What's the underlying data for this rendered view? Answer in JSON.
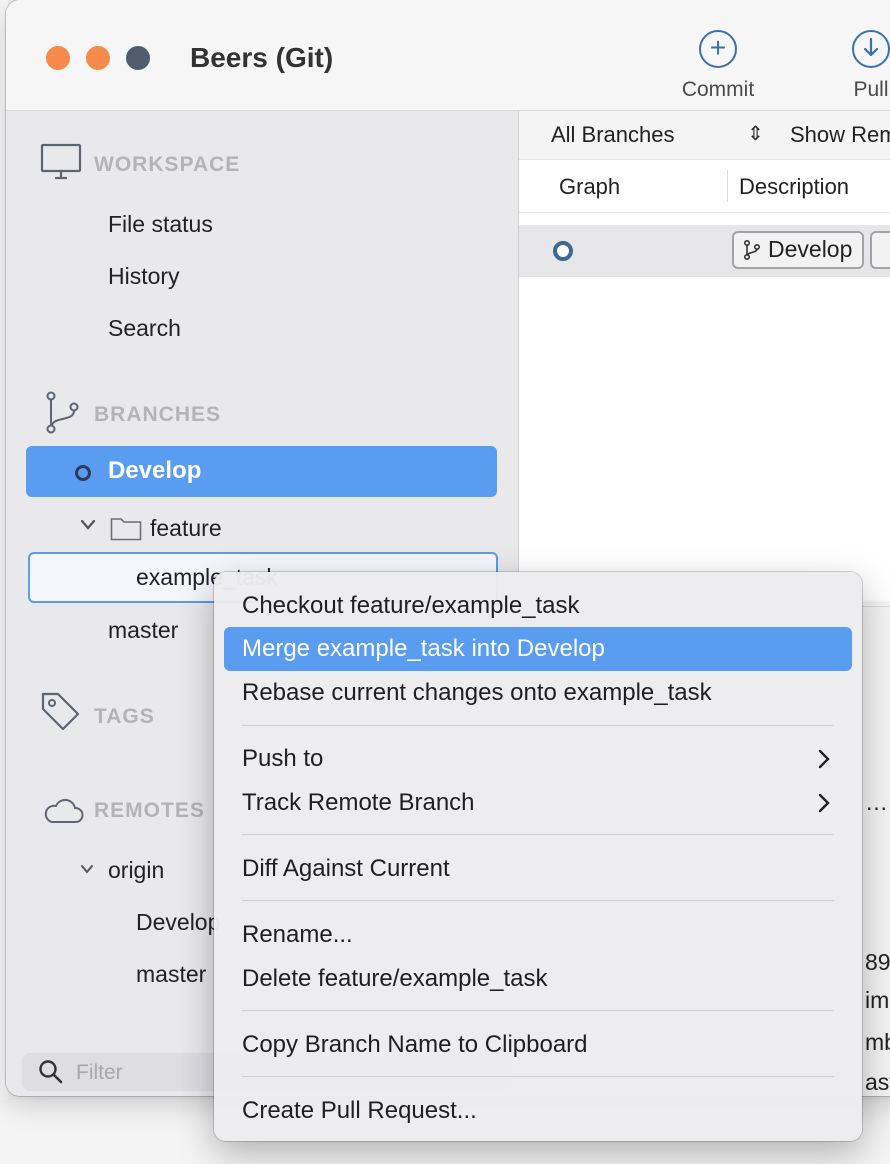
{
  "window": {
    "title": "Beers (Git)",
    "toolbar": {
      "commit_label": "Commit",
      "pull_label": "Pull"
    }
  },
  "sidebar": {
    "workspace": {
      "header": "WORKSPACE",
      "items": [
        "File status",
        "History",
        "Search"
      ]
    },
    "branches": {
      "header": "BRANCHES",
      "current": "Develop",
      "folder": "feature",
      "folder_item": "example_task",
      "master": "master"
    },
    "tags": {
      "header": "TAGS"
    },
    "remotes": {
      "header": "REMOTES",
      "origin": "origin",
      "origin_items": [
        "Develop",
        "master"
      ]
    },
    "filter_placeholder": "Filter"
  },
  "main": {
    "branch_selector": "All Branches",
    "show_remote_label": "Show Remote Branches",
    "columns": {
      "graph": "Graph",
      "description": "Description"
    },
    "commit_badge": "Develop",
    "edge_texts": [
      "…",
      "89",
      "im",
      "mb",
      "ast"
    ]
  },
  "context_menu": {
    "items": {
      "checkout": "Checkout feature/example_task",
      "merge": "Merge example_task into Develop",
      "rebase": "Rebase current changes onto example_task",
      "push_to": "Push to",
      "track_remote": "Track Remote Branch",
      "diff": "Diff Against Current",
      "rename": "Rename...",
      "delete": "Delete feature/example_task",
      "copy_name": "Copy Branch Name to Clipboard",
      "create_pr": "Create Pull Request..."
    },
    "highlighted": "merge"
  },
  "colors": {
    "accent": "#5a9cf0",
    "window_control": "#f58a4a",
    "toolbar_icon": "#3b6fb0"
  }
}
